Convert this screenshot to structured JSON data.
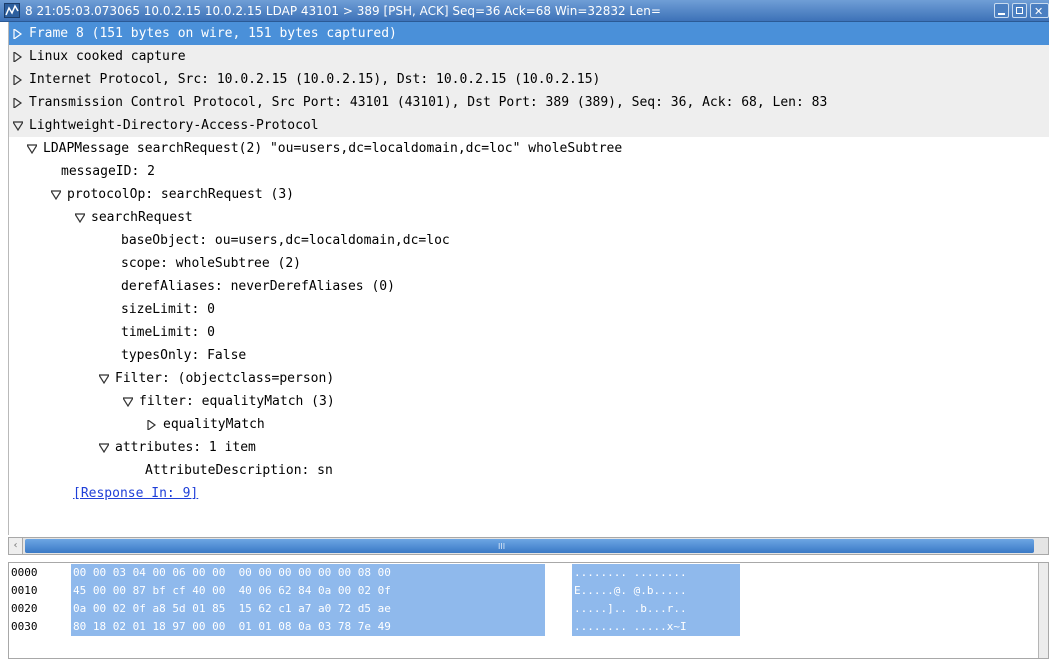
{
  "window": {
    "title": "8 21:05:03.073065 10.0.2.15 10.0.2.15 LDAP 43101 > 389 [PSH, ACK] Seq=36 Ack=68 Win=32832 Len="
  },
  "tree": [
    {
      "text": "Frame 8 (151 bytes on wire, 151 bytes captured)",
      "expander": "collapsed",
      "selected": true
    },
    {
      "text": "Linux cooked capture",
      "expander": "collapsed"
    },
    {
      "text": "Internet Protocol, Src: 10.0.2.15 (10.0.2.15), Dst: 10.0.2.15 (10.0.2.15)",
      "expander": "collapsed"
    },
    {
      "text": "Transmission Control Protocol, Src Port: 43101 (43101), Dst Port: 389 (389), Seq: 36, Ack: 68, Len: 83",
      "expander": "collapsed"
    },
    {
      "text": "Lightweight-Directory-Access-Protocol",
      "expander": "expanded"
    },
    {
      "text": "LDAPMessage searchRequest(2) \"ou=users,dc=localdomain,dc=loc\" wholeSubtree",
      "expander": "expanded"
    },
    {
      "text": "messageID: 2",
      "expander": "none"
    },
    {
      "text": "protocolOp: searchRequest (3)",
      "expander": "expanded"
    },
    {
      "text": "searchRequest",
      "expander": "expanded"
    },
    {
      "text": "baseObject: ou=users,dc=localdomain,dc=loc",
      "expander": "none"
    },
    {
      "text": "scope: wholeSubtree (2)",
      "expander": "none"
    },
    {
      "text": "derefAliases: neverDerefAliases (0)",
      "expander": "none"
    },
    {
      "text": "sizeLimit: 0",
      "expander": "none"
    },
    {
      "text": "timeLimit: 0",
      "expander": "none"
    },
    {
      "text": "typesOnly: False",
      "expander": "none"
    },
    {
      "text": "Filter: (objectclass=person)",
      "expander": "expanded"
    },
    {
      "text": "filter: equalityMatch (3)",
      "expander": "expanded"
    },
    {
      "text": "equalityMatch",
      "expander": "collapsed"
    },
    {
      "text": "attributes: 1 item",
      "expander": "expanded"
    },
    {
      "text": "AttributeDescription: sn",
      "expander": "none"
    },
    {
      "text": "[Response In: 9]",
      "expander": "none",
      "link": true
    }
  ],
  "scrollbar": {
    "grip": "III"
  },
  "hex": [
    {
      "offset": "0000",
      "bytes": "00 00 03 04 00 06 00 00  00 00 00 00 00 00 08 00",
      "ascii": "........ ........"
    },
    {
      "offset": "0010",
      "bytes": "45 00 00 87 bf cf 40 00  40 06 62 84 0a 00 02 0f",
      "ascii": "E.....@. @.b....."
    },
    {
      "offset": "0020",
      "bytes": "0a 00 02 0f a8 5d 01 85  15 62 c1 a7 a0 72 d5 ae",
      "ascii": ".....].. .b...r.."
    },
    {
      "offset": "0030",
      "bytes": "80 18 02 01 18 97 00 00  01 01 08 0a 03 78 7e 49",
      "ascii": "........ .....x~I"
    }
  ],
  "colors": {
    "selection": "#4a90d9",
    "section_shade": "#eeeeee",
    "hex_highlight": "#8fb9ec",
    "link": "#1f3fd8",
    "titlebar": "#3d72b8"
  }
}
